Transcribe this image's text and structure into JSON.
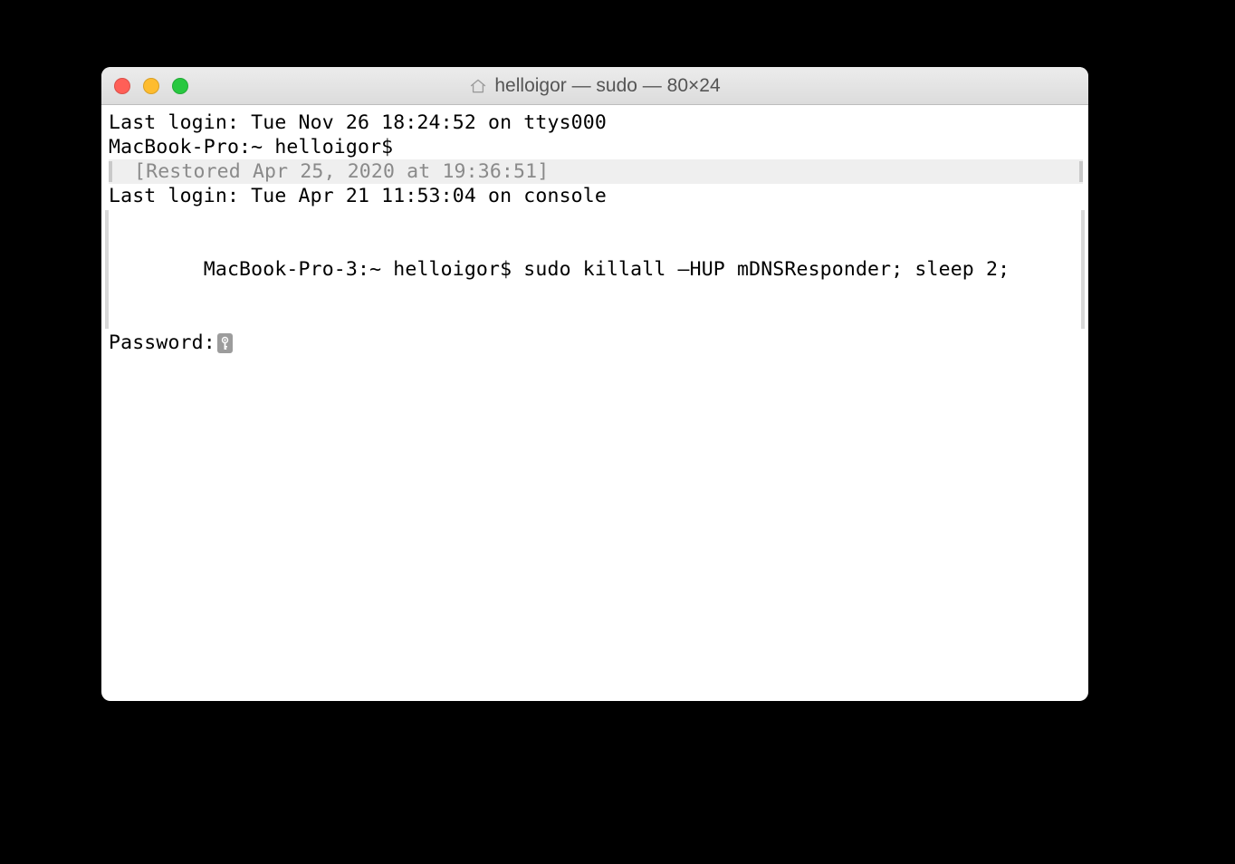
{
  "window": {
    "title": "helloigor — sudo — 80×24"
  },
  "terminal": {
    "lines": {
      "last_login_1": "Last login: Tue Nov 26 18:24:52 on ttys000",
      "prompt_1": "MacBook-Pro:~ helloigor$",
      "restored": "[Restored Apr 25, 2020 at 19:36:51]",
      "last_login_2": "Last login: Tue Apr 21 11:53:04 on console",
      "prompt_2": "MacBook-Pro-3:~ helloigor$ sudo killall –HUP mDNSResponder; sleep 2;",
      "password": "Password:"
    }
  },
  "icons": {
    "home": "home-icon",
    "key_cursor": "key-icon"
  }
}
